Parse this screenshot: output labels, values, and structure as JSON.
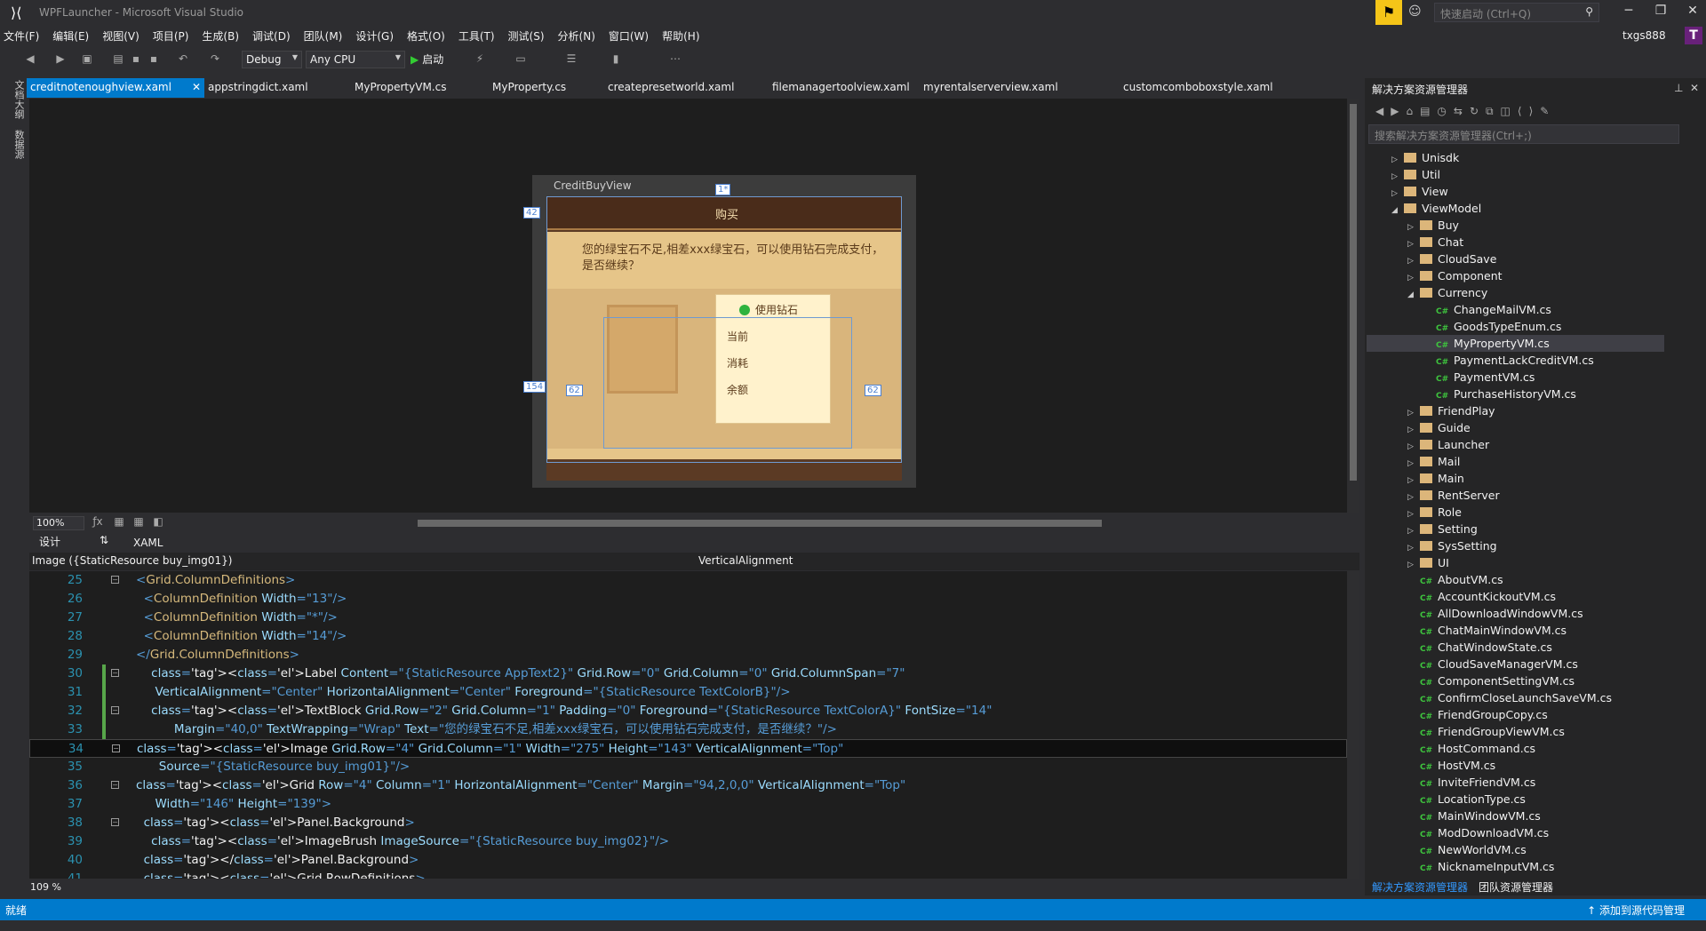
{
  "window": {
    "title": "WPFLauncher - Microsoft Visual Studio"
  },
  "quicklaunch": {
    "placeholder": "快速启动 (Ctrl+Q)"
  },
  "menu": [
    "文件(F)",
    "编辑(E)",
    "视图(V)",
    "项目(P)",
    "生成(B)",
    "调试(D)",
    "团队(M)",
    "设计(G)",
    "格式(O)",
    "工具(T)",
    "测试(S)",
    "分析(N)",
    "窗口(W)",
    "帮助(H)"
  ],
  "user": {
    "name": "txgs888",
    "avatar": "T"
  },
  "toolbar": {
    "config": "Debug",
    "platform": "Any CPU",
    "start": "启动"
  },
  "left_tabs": [
    "文档大纲",
    "数据源"
  ],
  "doc_tabs": [
    {
      "label": "creditnotenoughview.xaml",
      "active": true
    },
    {
      "label": "appstringdict.xaml"
    },
    {
      "label": "MyPropertyVM.cs"
    },
    {
      "label": "MyProperty.cs"
    },
    {
      "label": "createpresetworld.xaml"
    },
    {
      "label": "filemanagertoolview.xaml"
    },
    {
      "label": "myrentalserverview.xaml"
    },
    {
      "label": "customcomboboxstyle.xaml"
    }
  ],
  "designer": {
    "view_title": "CreditBuyView",
    "buy_title": "购买",
    "message": "您的绿宝石不足,相差xxx绿宝石，可以使用钻石完成支付，是否继续？",
    "use_diamond": "使用钻石",
    "current": "当前",
    "consume": "消耗",
    "balance": "余额",
    "grid_star": "1*",
    "grid_42": "42",
    "grid_154": "154",
    "margin_left": "62",
    "margin_right": "62",
    "zoom": "100%"
  },
  "pane_tabs": {
    "design": "设计",
    "swap": "⇅",
    "xaml": "XAML"
  },
  "addressbar": {
    "element": "Image ({StaticResource buy_img01})",
    "property": "VerticalAlignment"
  },
  "code_lines": [
    {
      "n": "25",
      "html": "<span class='tag'>&lt;</span><span class='el'>Grid.ColumnDefinitions</span><span class='tag'>&gt;</span>"
    },
    {
      "n": "26",
      "html": "  <span class='tag'>&lt;</span><span class='el'>ColumnDefinition</span> <span class='at'>Width</span><span class='tag'>=\"</span><span class='st'>13</span><span class='tag'>\"/&gt;</span>"
    },
    {
      "n": "27",
      "html": "  <span class='tag'>&lt;</span><span class='el'>ColumnDefinition</span> <span class='at'>Width</span><span class='tag'>=\"</span><span class='st'>*</span><span class='tag'>\"/&gt;</span>"
    },
    {
      "n": "28",
      "html": "  <span class='tag'>&lt;</span><span class='el'>ColumnDefinition</span> <span class='at'>Width</span><span class='tag'>=\"</span><span class='st'>14</span><span class='tag'>\"/&gt;</span>"
    },
    {
      "n": "29",
      "html": "<span class='tag'>&lt;/</span><span class='el'>Grid.ColumnDefinitions</span><span class='tag'>&gt;</span>"
    }
  ],
  "code_text": [
    {
      "n": "30",
      "t": "    <Label Content=\"{StaticResource AppText2}\" Grid.Row=\"0\" Grid.Column=\"0\" Grid.ColumnSpan=\"7\""
    },
    {
      "n": "31",
      "t": "     VerticalAlignment=\"Center\" HorizontalAlignment=\"Center\" Foreground=\"{StaticResource TextColorB}\"/>"
    },
    {
      "n": "32",
      "t": "    <TextBlock Grid.Row=\"2\" Grid.Column=\"1\" Padding=\"0\" Foreground=\"{StaticResource TextColorA}\" FontSize=\"14\""
    },
    {
      "n": "33",
      "t": "          Margin=\"40,0\" TextWrapping=\"Wrap\" Text=\"您的绿宝石不足,相差xxx绿宝石，可以使用钻石完成支付，是否继续？\"/>"
    },
    {
      "n": "34",
      "t": "<Image Grid.Row=\"4\" Grid.Column=\"1\" Width=\"275\" Height=\"143\" VerticalAlignment=\"Top\""
    },
    {
      "n": "35",
      "t": "      Source=\"{StaticResource buy_img01}\"/>"
    },
    {
      "n": "36",
      "t": "<Grid Row=\"4\" Column=\"1\" HorizontalAlignment=\"Center\" Margin=\"94,2,0,0\" VerticalAlignment=\"Top\""
    },
    {
      "n": "37",
      "t": "     Width=\"146\" Height=\"139\">"
    },
    {
      "n": "38",
      "t": "  <Panel.Background>"
    },
    {
      "n": "39",
      "t": "    <ImageBrush ImageSource=\"{StaticResource buy_img02}\"/>"
    },
    {
      "n": "40",
      "t": "  </Panel.Background>"
    },
    {
      "n": "41",
      "t": "  <Grid.RowDefinitions>"
    }
  ],
  "editor_zoom": "109 %",
  "status": {
    "ready": "就绪",
    "source_control": "添加到源代码管理"
  },
  "solution": {
    "title": "解决方案资源管理器",
    "search_placeholder": "搜索解决方案资源管理器(Ctrl+;)",
    "tabs": [
      "解决方案资源管理器",
      "团队资源管理器"
    ],
    "nodes": [
      {
        "label": "Unisdk",
        "kind": "folder",
        "depth": 2,
        "exp": "right"
      },
      {
        "label": "Util",
        "kind": "folder",
        "depth": 2,
        "exp": "right"
      },
      {
        "label": "View",
        "kind": "folder",
        "depth": 2,
        "exp": "right"
      },
      {
        "label": "ViewModel",
        "kind": "folder",
        "depth": 2,
        "exp": "down"
      },
      {
        "label": "Buy",
        "kind": "folder",
        "depth": 3,
        "exp": "right"
      },
      {
        "label": "Chat",
        "kind": "folder",
        "depth": 3,
        "exp": "right"
      },
      {
        "label": "CloudSave",
        "kind": "folder",
        "depth": 3,
        "exp": "right"
      },
      {
        "label": "Component",
        "kind": "folder",
        "depth": 3,
        "exp": "right"
      },
      {
        "label": "Currency",
        "kind": "folder",
        "depth": 3,
        "exp": "down"
      },
      {
        "label": "ChangeMailVM.cs",
        "kind": "cs",
        "depth": 4
      },
      {
        "label": "GoodsTypeEnum.cs",
        "kind": "cs",
        "depth": 4
      },
      {
        "label": "MyPropertyVM.cs",
        "kind": "cs",
        "depth": 4,
        "selected": true
      },
      {
        "label": "PaymentLackCreditVM.cs",
        "kind": "cs",
        "depth": 4
      },
      {
        "label": "PaymentVM.cs",
        "kind": "cs",
        "depth": 4
      },
      {
        "label": "PurchaseHistoryVM.cs",
        "kind": "cs",
        "depth": 4
      },
      {
        "label": "FriendPlay",
        "kind": "folder",
        "depth": 3,
        "exp": "right"
      },
      {
        "label": "Guide",
        "kind": "folder",
        "depth": 3,
        "exp": "right"
      },
      {
        "label": "Launcher",
        "kind": "folder",
        "depth": 3,
        "exp": "right"
      },
      {
        "label": "Mail",
        "kind": "folder",
        "depth": 3,
        "exp": "right"
      },
      {
        "label": "Main",
        "kind": "folder",
        "depth": 3,
        "exp": "right"
      },
      {
        "label": "RentServer",
        "kind": "folder",
        "depth": 3,
        "exp": "right"
      },
      {
        "label": "Role",
        "kind": "folder",
        "depth": 3,
        "exp": "right"
      },
      {
        "label": "Setting",
        "kind": "folder",
        "depth": 3,
        "exp": "right"
      },
      {
        "label": "SysSetting",
        "kind": "folder",
        "depth": 3,
        "exp": "right"
      },
      {
        "label": "UI",
        "kind": "folder",
        "depth": 3,
        "exp": "right"
      },
      {
        "label": "AboutVM.cs",
        "kind": "cs",
        "depth": 3
      },
      {
        "label": "AccountKickoutVM.cs",
        "kind": "cs",
        "depth": 3
      },
      {
        "label": "AllDownloadWindowVM.cs",
        "kind": "cs",
        "depth": 3
      },
      {
        "label": "ChatMainWindowVM.cs",
        "kind": "cs",
        "depth": 3
      },
      {
        "label": "ChatWindowState.cs",
        "kind": "cs",
        "depth": 3
      },
      {
        "label": "CloudSaveManagerVM.cs",
        "kind": "cs",
        "depth": 3
      },
      {
        "label": "ComponentSettingVM.cs",
        "kind": "cs",
        "depth": 3
      },
      {
        "label": "ConfirmCloseLaunchSaveVM.cs",
        "kind": "cs",
        "depth": 3
      },
      {
        "label": "FriendGroupCopy.cs",
        "kind": "cs",
        "depth": 3
      },
      {
        "label": "FriendGroupViewVM.cs",
        "kind": "cs",
        "depth": 3
      },
      {
        "label": "HostCommand.cs",
        "kind": "cs",
        "depth": 3
      },
      {
        "label": "HostVM.cs",
        "kind": "cs",
        "depth": 3
      },
      {
        "label": "InviteFriendVM.cs",
        "kind": "cs",
        "depth": 3
      },
      {
        "label": "LocationType.cs",
        "kind": "cs",
        "depth": 3
      },
      {
        "label": "MainWindowVM.cs",
        "kind": "cs",
        "depth": 3
      },
      {
        "label": "ModDownloadVM.cs",
        "kind": "cs",
        "depth": 3
      },
      {
        "label": "NewWorldVM.cs",
        "kind": "cs",
        "depth": 3
      },
      {
        "label": "NicknameInputVM.cs",
        "kind": "cs",
        "depth": 3
      }
    ]
  }
}
